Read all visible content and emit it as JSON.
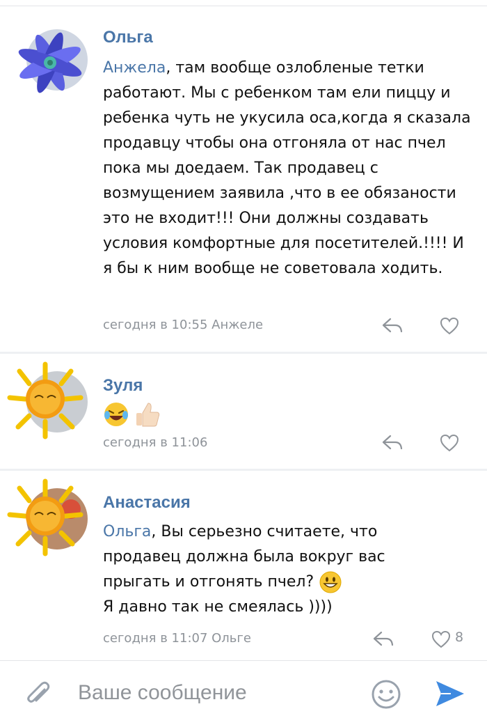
{
  "comments": [
    {
      "author": "Ольга",
      "mention": "Анжела",
      "text": ", там вообще озлобленые тетки работают. Мы с ребенком там ели пиццу и ребенка чуть не укусила оса,когда я сказала продавцу чтобы она отгоняла от нас пчел пока мы доедаем. Так продавец с возмущением заявила ,что в ее обязаности это не входит!!! Они должны создавать условия комфортные для посетителей.!!!! И я бы к ним вообще не советовала ходить.",
      "meta": "сегодня в 10:55 Анжеле",
      "likes": ""
    },
    {
      "author": "Зуля",
      "text": "",
      "meta": "сегодня в 11:06",
      "likes": ""
    },
    {
      "author": "Анастасия",
      "mention": "Ольга",
      "text_line1": ", Вы серьезно считаете, что",
      "text_line2": "продавец должна была вокруг вас",
      "text_line3": "прыгать и отгонять пчел?",
      "text_line4": "Я давно так не смеялась ))))",
      "meta": "сегодня в 11:07 Ольге",
      "likes": "8"
    }
  ],
  "composer": {
    "placeholder": "Ваше сообщение"
  },
  "icons": {
    "attach": "paperclip-icon",
    "emoji": "smile-icon",
    "send": "send-icon",
    "reply": "reply-icon",
    "like": "heart-icon"
  },
  "colors": {
    "accent": "#4a76a8",
    "meta": "#8e9399",
    "send": "#3f8ae0"
  }
}
